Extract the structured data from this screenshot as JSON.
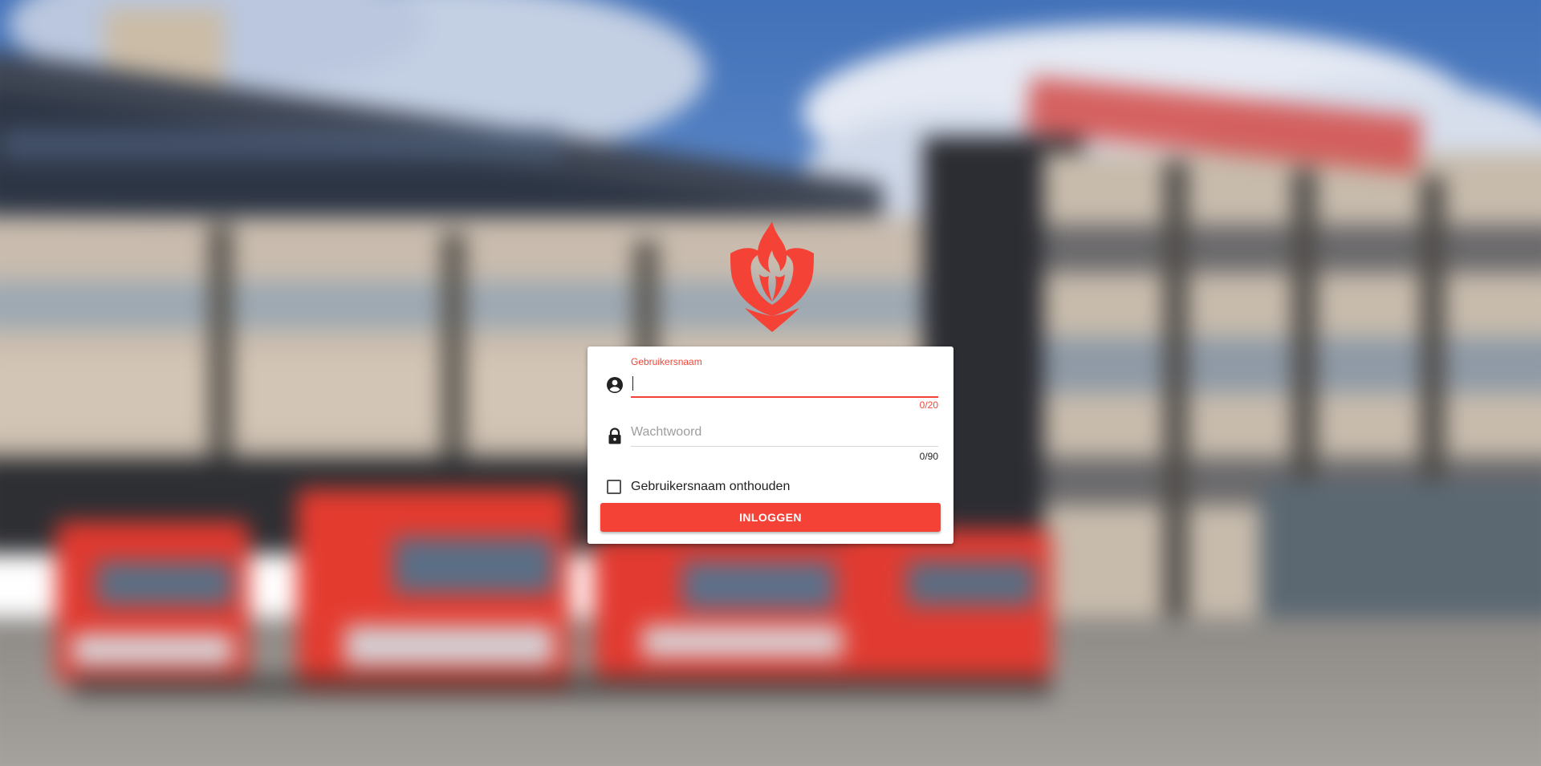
{
  "login": {
    "username_label": "Gebruikersnaam",
    "username_value": "",
    "username_counter": "0/20",
    "password_placeholder": "Wachtwoord",
    "password_value": "",
    "password_counter": "0/90",
    "remember_label": "Gebruikersnaam onthouden",
    "remember_checked": false,
    "submit_label": "INLOGGEN"
  },
  "icons": {
    "username": "account-circle-icon",
    "password": "lock-icon",
    "logo": "brandweer-flame-logo"
  },
  "colors": {
    "accent": "#f44336",
    "card_background": "#ffffff",
    "text": "#222222",
    "placeholder": "#9e9e9e"
  }
}
